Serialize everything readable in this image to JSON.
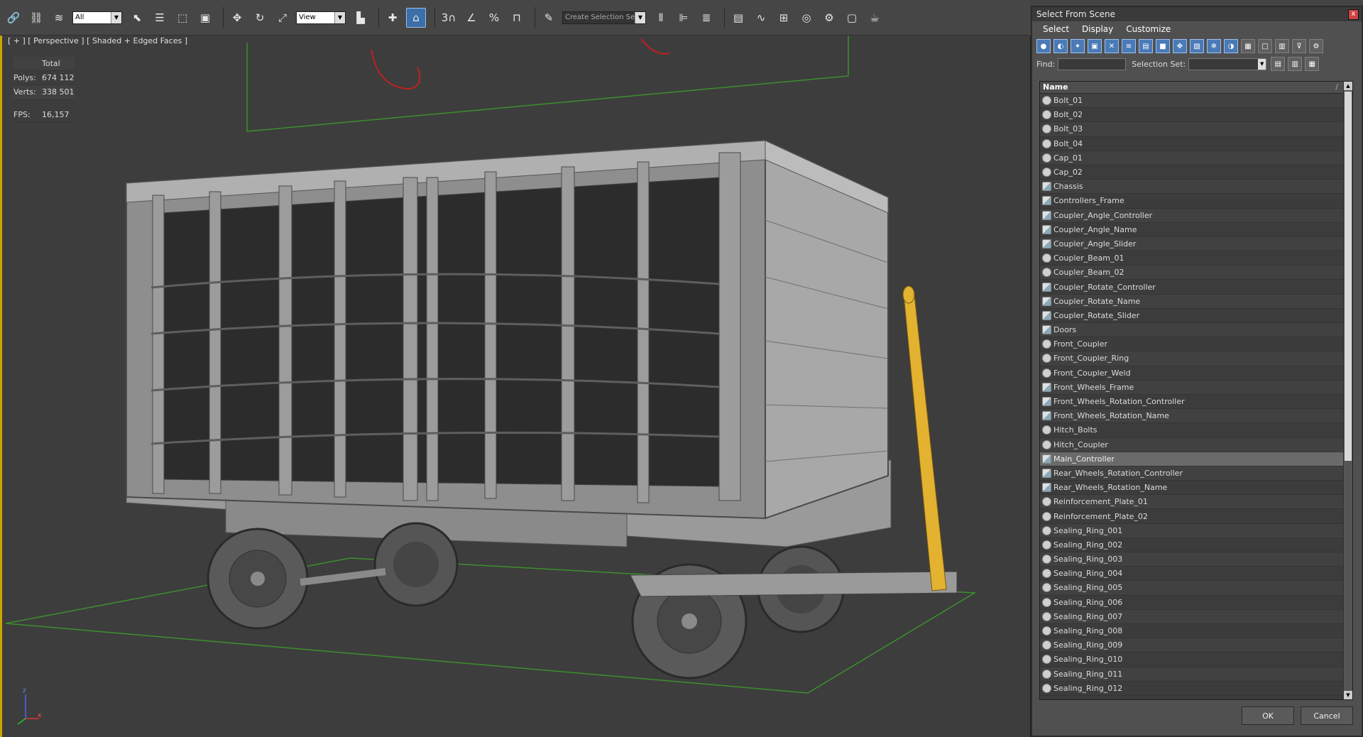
{
  "toolbar": {
    "filter_value": "All",
    "ref_coord_value": "View",
    "selection_set_placeholder": "Create Selection Se",
    "spinner_snap_label": "3",
    "icons": [
      "select-link-icon",
      "unlink-icon",
      "bind-spacewarp-icon",
      "select-object-icon",
      "select-by-name-icon",
      "rect-region-icon",
      "window-crossing-icon",
      "move-icon",
      "rotate-icon",
      "scale-icon",
      "pivot-icon",
      "select-manipulate-icon",
      "keyboard-shortcut-icon",
      "snap-toggle-icon",
      "angle-snap-icon",
      "percent-snap-icon",
      "spinner-snap-icon",
      "edit-named-sets-icon",
      "mirror-icon",
      "align-icon",
      "layer-manager-icon",
      "scene-explorer-icon",
      "curve-editor-icon",
      "schematic-view-icon",
      "material-editor-icon",
      "render-setup-icon",
      "rendered-frame-icon",
      "render-icon"
    ]
  },
  "viewport": {
    "label": "[ + ] [ Perspective ] [ Shaded + Edged Faces ]",
    "stats": {
      "total_label": "Total",
      "polys_label": "Polys:",
      "polys_value": "674 112",
      "verts_label": "Verts:",
      "verts_value": "338 501",
      "fps_label": "FPS:",
      "fps_value": "16,157"
    },
    "axis_z": "z",
    "axis_x": "x"
  },
  "dialog": {
    "title": "Select From Scene",
    "close": "x",
    "menu": [
      "Select",
      "Display",
      "Customize"
    ],
    "find_label": "Find:",
    "selection_set_label": "Selection Set:",
    "column_name": "Name",
    "column_sort": "/",
    "ok_label": "OK",
    "cancel_label": "Cancel",
    "selected_item": "Main_Controller",
    "items": [
      {
        "name": "Bolt_01",
        "type": "geometry"
      },
      {
        "name": "Bolt_02",
        "type": "geometry"
      },
      {
        "name": "Bolt_03",
        "type": "geometry"
      },
      {
        "name": "Bolt_04",
        "type": "geometry"
      },
      {
        "name": "Cap_01",
        "type": "geometry"
      },
      {
        "name": "Cap_02",
        "type": "geometry"
      },
      {
        "name": "Chassis",
        "type": "group"
      },
      {
        "name": "Controllers_Frame",
        "type": "group"
      },
      {
        "name": "Coupler_Angle_Controller",
        "type": "group"
      },
      {
        "name": "Coupler_Angle_Name",
        "type": "group"
      },
      {
        "name": "Coupler_Angle_Slider",
        "type": "group"
      },
      {
        "name": "Coupler_Beam_01",
        "type": "geometry"
      },
      {
        "name": "Coupler_Beam_02",
        "type": "geometry"
      },
      {
        "name": "Coupler_Rotate_Controller",
        "type": "group"
      },
      {
        "name": "Coupler_Rotate_Name",
        "type": "group"
      },
      {
        "name": "Coupler_Rotate_Slider",
        "type": "group"
      },
      {
        "name": "Doors",
        "type": "group"
      },
      {
        "name": "Front_Coupler",
        "type": "geometry"
      },
      {
        "name": "Front_Coupler_Ring",
        "type": "geometry"
      },
      {
        "name": "Front_Coupler_Weld",
        "type": "geometry"
      },
      {
        "name": "Front_Wheels_Frame",
        "type": "group"
      },
      {
        "name": "Front_Wheels_Rotation_Controller",
        "type": "group"
      },
      {
        "name": "Front_Wheels_Rotation_Name",
        "type": "group"
      },
      {
        "name": "Hitch_Bolts",
        "type": "geometry"
      },
      {
        "name": "Hitch_Coupler",
        "type": "geometry"
      },
      {
        "name": "Main_Controller",
        "type": "group"
      },
      {
        "name": "Rear_Wheels_Rotation_Controller",
        "type": "group"
      },
      {
        "name": "Rear_Wheels_Rotation_Name",
        "type": "group"
      },
      {
        "name": "Reinforcement_Plate_01",
        "type": "geometry"
      },
      {
        "name": "Reinforcement_Plate_02",
        "type": "geometry"
      },
      {
        "name": "Sealing_Ring_001",
        "type": "geometry"
      },
      {
        "name": "Sealing_Ring_002",
        "type": "geometry"
      },
      {
        "name": "Sealing_Ring_003",
        "type": "geometry"
      },
      {
        "name": "Sealing_Ring_004",
        "type": "geometry"
      },
      {
        "name": "Sealing_Ring_005",
        "type": "geometry"
      },
      {
        "name": "Sealing_Ring_006",
        "type": "geometry"
      },
      {
        "name": "Sealing_Ring_007",
        "type": "geometry"
      },
      {
        "name": "Sealing_Ring_008",
        "type": "geometry"
      },
      {
        "name": "Sealing_Ring_009",
        "type": "geometry"
      },
      {
        "name": "Sealing_Ring_010",
        "type": "geometry"
      },
      {
        "name": "Sealing_Ring_011",
        "type": "geometry"
      },
      {
        "name": "Sealing_Ring_012",
        "type": "geometry"
      }
    ]
  }
}
